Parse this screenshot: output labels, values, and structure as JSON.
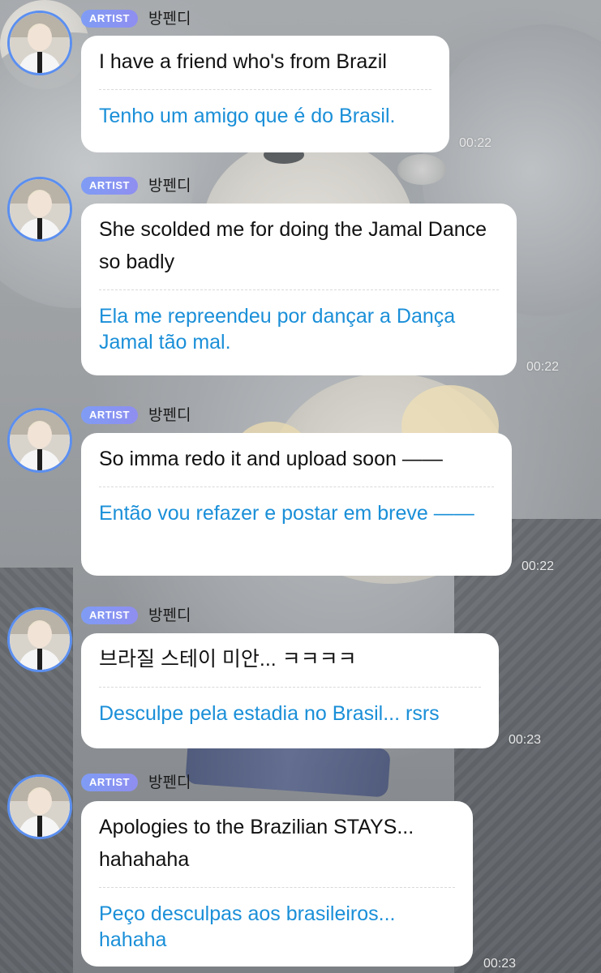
{
  "sender": {
    "badge": "ARTIST",
    "name": "방펜디"
  },
  "messages": [
    {
      "original": "I have a friend who's from Brazil",
      "translation": "Tenho um amigo que é do Brasil.",
      "time": "00:22"
    },
    {
      "original": "She scolded me for doing the Jamal Dance so badly",
      "translation": "Ela me repreendeu por dançar a Dança Jamal tão mal.",
      "time": "00:22"
    },
    {
      "original": "So imma redo it and upload soon ——",
      "translation": "Então vou refazer e postar em breve ——",
      "time": "00:22"
    },
    {
      "original": "브라질 스테이 미안... ㅋㅋㅋㅋ",
      "translation": "Desculpe pela estadia no Brasil... rsrs",
      "time": "00:23"
    },
    {
      "original": "Apologies to the Brazilian STAYS... hahahaha",
      "translation": "Peço desculpas aos brasileiros... hahaha",
      "time": "00:23"
    }
  ],
  "colors": {
    "badge": "#8a95f2",
    "avatar_ring": "#5b8ff0",
    "translation_text": "#1a8fd8",
    "bubble": "#ffffff"
  }
}
